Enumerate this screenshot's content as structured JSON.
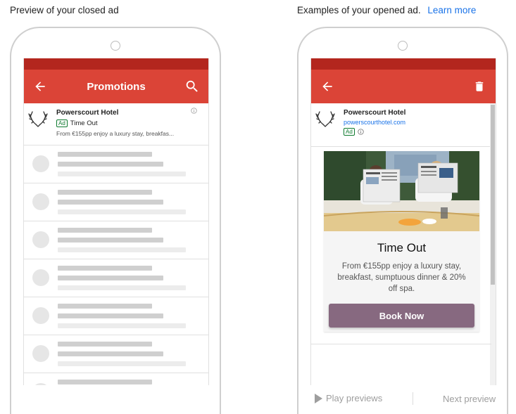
{
  "left_panel": {
    "caption": "Preview of your closed ad",
    "app_bar": {
      "back_icon": "arrow-back-icon",
      "title": "Promotions",
      "search_icon": "search-icon"
    },
    "ad": {
      "logo_icon": "deer-antlers-icon",
      "sender": "Powerscourt Hotel",
      "badge": "Ad",
      "subject": "Time Out",
      "snippet": "From €155pp enjoy a luxury stay, breakfas...",
      "info_icon": "info-icon"
    }
  },
  "right_panel": {
    "caption": "Examples of your opened ad.",
    "learn_more": "Learn more",
    "app_bar": {
      "back_icon": "arrow-back-icon",
      "delete_icon": "trash-icon"
    },
    "ad_header": {
      "logo_icon": "deer-antlers-icon",
      "sender": "Powerscourt Hotel",
      "url": "powerscourthotel.com",
      "badge": "Ad",
      "info_icon": "info-icon"
    },
    "card": {
      "headline": "Time Out",
      "description": "From €155pp enjoy a luxury stay, breakfast, sumptuous dinner & 20% off spa.",
      "cta": "Book Now",
      "cta_color": "#876980"
    }
  },
  "controls": {
    "play_icon": "play-icon",
    "play": "Play previews",
    "next": "Next preview"
  },
  "colors": {
    "app_bar": "#db4437",
    "status_bar": "#b3261e",
    "link": "#1a73e8",
    "ad_badge": "#0d7a2e"
  }
}
